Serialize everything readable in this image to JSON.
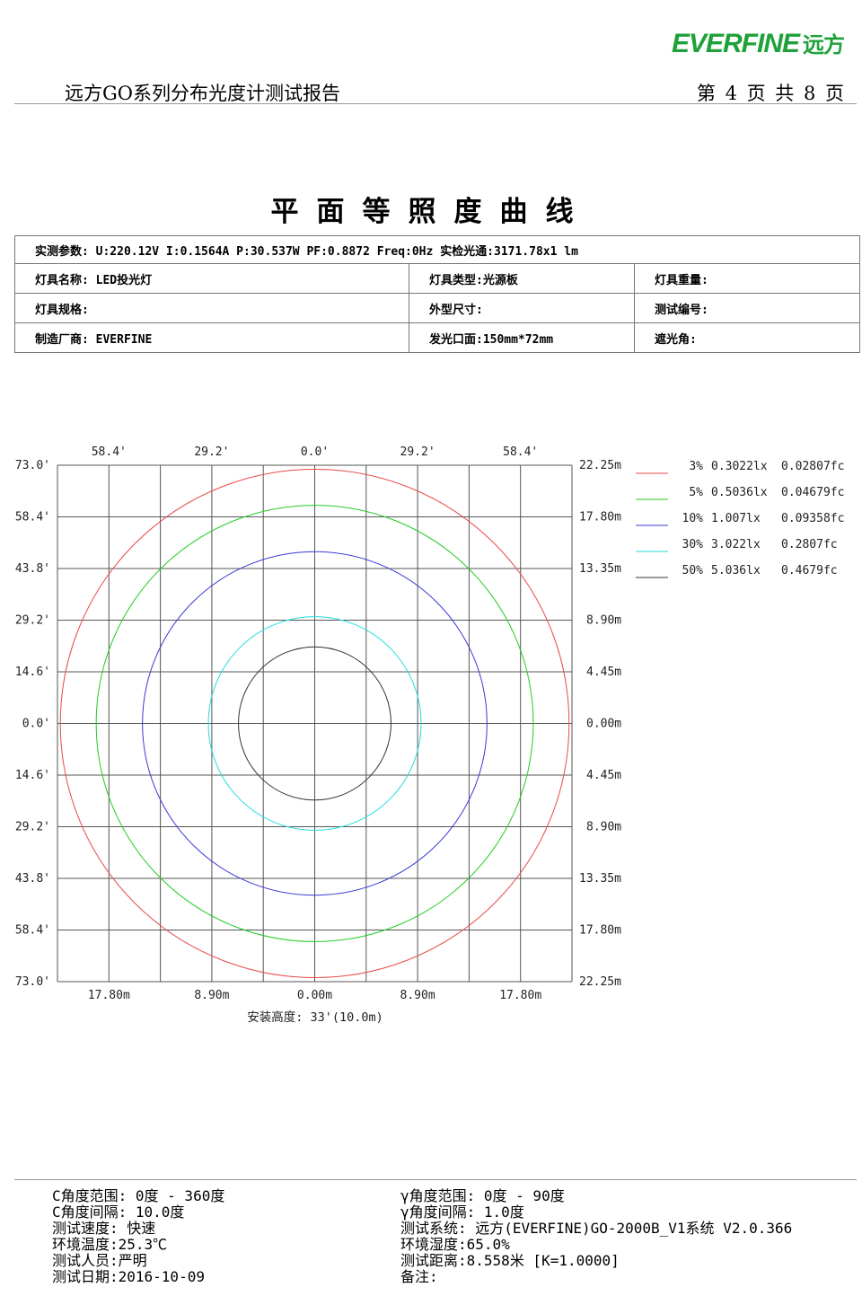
{
  "header": {
    "logo_text": "EVERFINE",
    "logo_cn": "远方",
    "title": "远方GO系列分布光度计测试报告",
    "page": "第 4 页  共 8 页"
  },
  "main_title": "平面等照度曲线",
  "info": {
    "row1": "实测参数: U:220.12V I:0.1564A P:30.537W PF:0.8872 Freq:0Hz  实检光通:3171.78x1 lm",
    "lamp_name": "灯具名称: LED投光灯",
    "lamp_type": "灯具类型:光源板",
    "lamp_weight": "灯具重量:",
    "lamp_spec": "灯具规格:",
    "dimension": "外型尺寸:",
    "test_no": "测试编号:",
    "manufacturer": "制造厂商: EVERFINE",
    "emitting_face": "发光口面:150mm*72mm",
    "shading_angle": "遮光角:"
  },
  "chart_data": {
    "type": "isolux",
    "top_labels": [
      "58.4'",
      "29.2'",
      "0.0'",
      "29.2'",
      "58.4'"
    ],
    "bottom_labels": [
      "17.80m",
      "8.90m",
      "0.00m",
      "8.90m",
      "17.80m"
    ],
    "left_labels": [
      "73.0'",
      "58.4'",
      "43.8'",
      "29.2'",
      "14.6'",
      "0.0'",
      "14.6'",
      "29.2'",
      "43.8'",
      "58.4'",
      "73.0'"
    ],
    "right_labels": [
      "22.25m",
      "17.80m",
      "13.35m",
      "8.90m",
      "4.45m",
      "0.00m",
      "4.45m",
      "8.90m",
      "13.35m",
      "17.80m",
      "22.25m"
    ],
    "xlim_m": [
      -22.25,
      22.25
    ],
    "ylim_m": [
      -22.25,
      22.25
    ],
    "grid": true,
    "mounting_height": "安装高度: 33'(10.0m)",
    "contours": [
      {
        "percent": "3%",
        "lux": "0.3022lx",
        "fc": "0.02807fc",
        "color": "#e84a4a",
        "rx_m": 22.0,
        "ry_m": 21.9
      },
      {
        "percent": "5%",
        "lux": "0.5036lx",
        "fc": "0.04679fc",
        "color": "#22cc22",
        "rx_m": 18.9,
        "ry_m": 18.8
      },
      {
        "percent": "10%",
        "lux": "1.007lx",
        "fc": "0.09358fc",
        "color": "#3a3ad6",
        "rx_m": 14.9,
        "ry_m": 14.8
      },
      {
        "percent": "30%",
        "lux": "3.022lx",
        "fc": "0.2807fc",
        "color": "#22dddd",
        "rx_m": 9.2,
        "ry_m": 9.2
      },
      {
        "percent": "50%",
        "lux": "5.036lx",
        "fc": "0.4679fc",
        "color": "#333333",
        "rx_m": 6.6,
        "ry_m": 6.6
      }
    ]
  },
  "footer": {
    "left": [
      "C角度范围:  0度 - 360度",
      "C角度间隔: 10.0度",
      "测试速度: 快速",
      "环境温度:25.3℃",
      "测试人员:严明",
      "测试日期:2016-10-09"
    ],
    "right": [
      "γ角度范围:  0度 -  90度",
      "γ角度间隔:  1.0度",
      "测试系统: 远方(EVERFINE)GO-2000B_V1系统 V2.0.366",
      "环境湿度:65.0%",
      "测试距离:8.558米 [K=1.0000]",
      "备注:"
    ]
  }
}
